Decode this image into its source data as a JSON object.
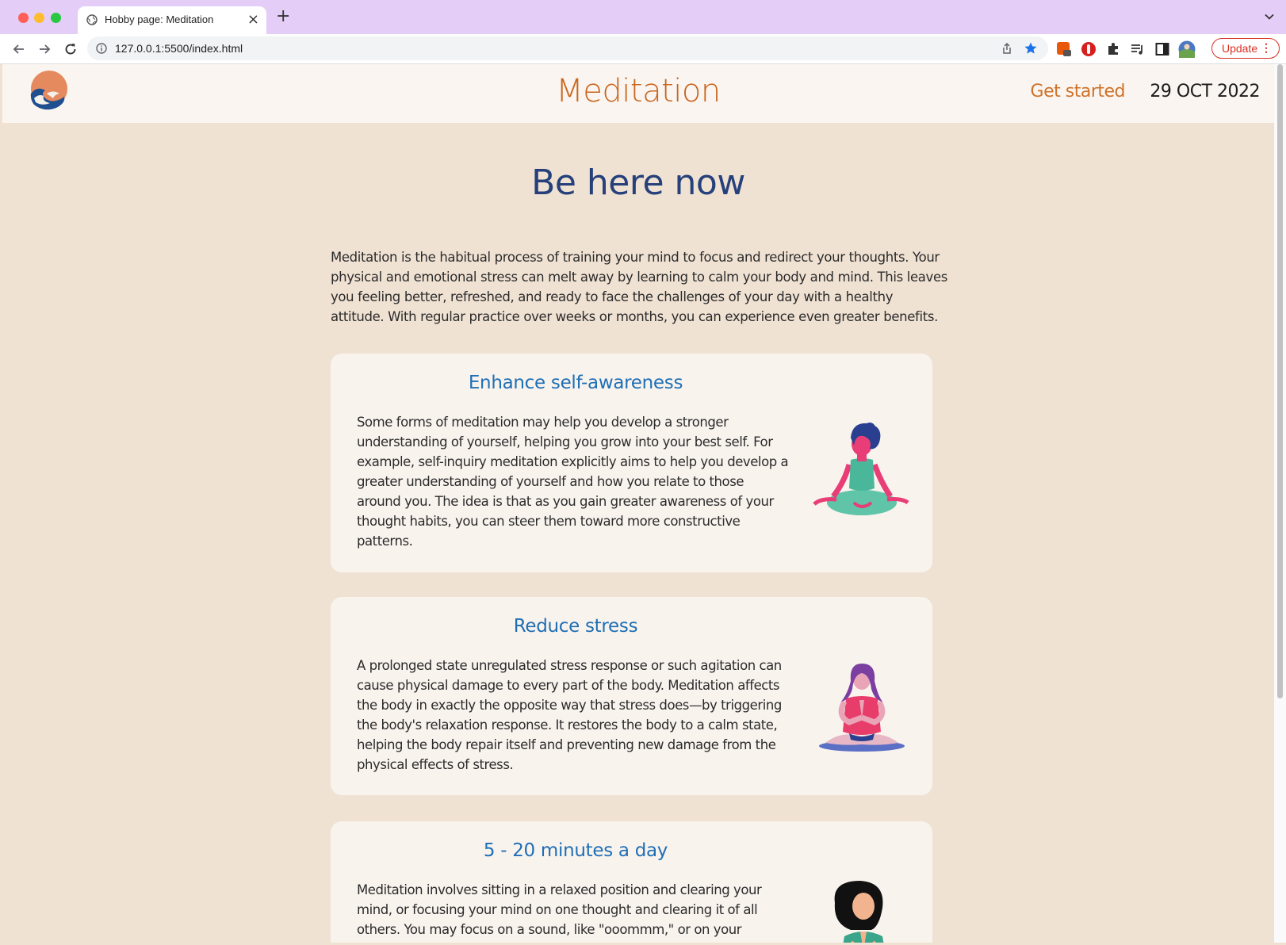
{
  "browser": {
    "tab_title": "Hobby page: Meditation",
    "url": "127.0.0.1:5500/index.html",
    "update_label": "Update",
    "new_tab_symbol": "+",
    "close_symbol": "×",
    "menu_symbol": "⋮"
  },
  "header": {
    "title": "Meditation",
    "cta": "Get started",
    "date": "29 OCT 2022"
  },
  "hero": {
    "title": "Be here now",
    "intro": "Meditation is the habitual process of training your mind to focus and redirect your thoughts. Your physical and emotional stress can melt away by learning to calm your body and mind. This leaves you feeling better, refreshed, and ready to face the challenges of your day with a healthy attitude. With regular practice over weeks or months, you can experience even greater benefits."
  },
  "cards": [
    {
      "title": "Enhance self-awareness",
      "body": "Some forms of meditation may help you develop a stronger understanding of yourself, helping you grow into your best self. For example, self-inquiry meditation explicitly aims to help you develop a greater understanding of yourself and how you relate to those around you. The idea is that as you gain greater awareness of your thought habits, you can steer them toward more constructive patterns."
    },
    {
      "title": "Reduce stress",
      "body": "A prolonged state unregulated stress response or such agitation can cause physical damage to every part of the body. Meditation affects the body in exactly the opposite way that stress does—by triggering the body's relaxation response. It restores the body to a calm state, helping the body repair itself and preventing new damage from the physical effects of stress."
    },
    {
      "title": "5 - 20 minutes a day",
      "body": "Meditation involves sitting in a relaxed position and clearing your mind, or focusing your mind on one thought and clearing it of all others. You may focus on a sound, like \"ooommm,\" or on your"
    }
  ],
  "colors": {
    "page_bg": "#f0e2d3",
    "card_bg": "#f9f3ee",
    "brand_orange": "#c9661f",
    "hero_blue": "#25407a",
    "card_title_blue": "#1f6fb5",
    "tab_strip": "#e4cdf7"
  },
  "icons": {
    "logo": "sun-wave-logo",
    "card_1": "meditating-woman-lotus-icon",
    "card_2": "praying-woman-lotus-icon",
    "card_3": "woman-namaste-icon"
  }
}
